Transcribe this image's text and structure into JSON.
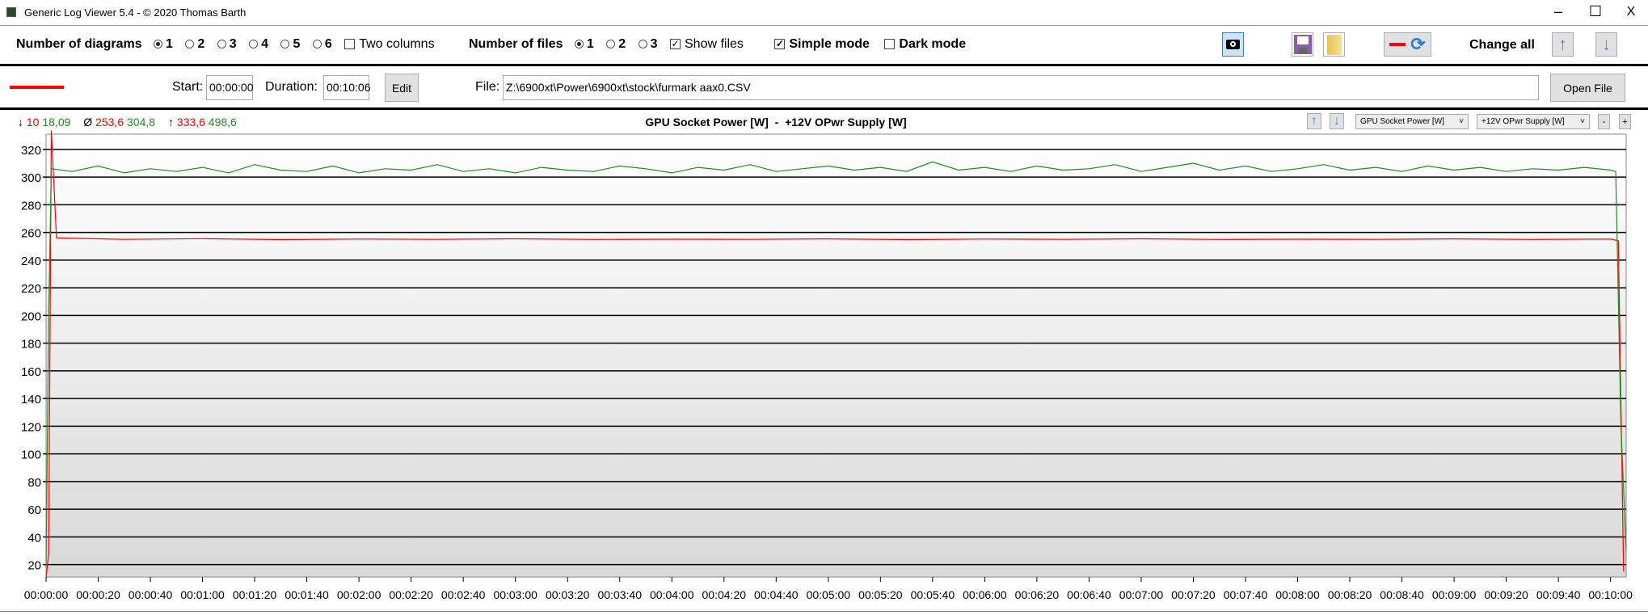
{
  "window": {
    "title": "Generic Log Viewer 5.4 - © 2020 Thomas Barth",
    "minimize": "–",
    "maximize": "☐",
    "close": "X"
  },
  "toolbar": {
    "diagrams_label": "Number of diagrams",
    "diagram_options": [
      "1",
      "2",
      "3",
      "4",
      "5",
      "6"
    ],
    "diagrams_selected": "1",
    "two_columns": "Two columns",
    "two_columns_checked": false,
    "files_label": "Number of files",
    "file_options": [
      "1",
      "2",
      "3"
    ],
    "files_selected": "1",
    "show_files": "Show files",
    "show_files_checked": true,
    "simple_mode": "Simple mode",
    "simple_mode_checked": true,
    "dark_mode": "Dark mode",
    "dark_mode_checked": false,
    "change_all": "Change all"
  },
  "file_row": {
    "line_color": "#ff0000",
    "start_label": "Start:",
    "start_value": "00:00:00",
    "duration_label": "Duration:",
    "duration_value": "00:10:06",
    "edit": "Edit",
    "file_label": "File:",
    "file_path": "Z:\\6900xt\\Power\\6900xt\\stock\\furmark aax0.CSV",
    "open_file": "Open File"
  },
  "stats": {
    "min_symbol": "↓",
    "min_a": "10",
    "min_b": "18,09",
    "avg_symbol": "Ø",
    "avg_a": "253,6",
    "avg_b": "304,8",
    "max_symbol": "↑",
    "max_a": "333,6",
    "max_b": "498,6"
  },
  "chart_header": {
    "title_a": "GPU Socket Power [W]",
    "sep": "-",
    "title_b": "+12V OPwr Supply [W]",
    "select_a": "GPU Socket Power [W]",
    "select_b": "+12V OPwr Supply [W]",
    "minus": "-",
    "plus": "+"
  },
  "chart_data": {
    "type": "line",
    "ylim": [
      11,
      331
    ],
    "yticks": [
      20,
      40,
      60,
      80,
      100,
      120,
      140,
      160,
      180,
      200,
      220,
      240,
      260,
      280,
      300,
      320
    ],
    "xticks": [
      "00:00:00",
      "00:00:20",
      "00:00:40",
      "00:01:00",
      "00:01:20",
      "00:01:40",
      "00:02:00",
      "00:02:20",
      "00:02:40",
      "00:03:00",
      "00:03:20",
      "00:03:40",
      "00:04:00",
      "00:04:20",
      "00:04:40",
      "00:05:00",
      "00:05:20",
      "00:05:40",
      "00:06:00",
      "00:06:20",
      "00:06:40",
      "00:07:00",
      "00:07:20",
      "00:07:40",
      "00:08:00",
      "00:08:20",
      "00:08:40",
      "00:09:00",
      "00:09:20",
      "00:09:40",
      "00:10:00"
    ],
    "xlim": [
      "00:00:00",
      "00:10:06"
    ],
    "grid": true,
    "series": [
      {
        "color": "#ff0000",
        "points": [
          [
            "00:00:00",
            10
          ],
          [
            "00:00:01",
            28
          ],
          [
            "00:00:02",
            333.6
          ],
          [
            "00:00:04",
            256
          ],
          [
            "00:00:30",
            255
          ],
          [
            "00:01:00",
            255.5
          ],
          [
            "00:01:30",
            254.8
          ],
          [
            "00:02:00",
            255.2
          ],
          [
            "00:02:30",
            255
          ],
          [
            "00:03:00",
            255.4
          ],
          [
            "00:03:30",
            254.9
          ],
          [
            "00:04:00",
            255.1
          ],
          [
            "00:04:30",
            255
          ],
          [
            "00:05:00",
            255.3
          ],
          [
            "00:05:30",
            254.8
          ],
          [
            "00:06:00",
            255.2
          ],
          [
            "00:06:30",
            255
          ],
          [
            "00:07:00",
            255.4
          ],
          [
            "00:07:30",
            254.9
          ],
          [
            "00:08:00",
            255.1
          ],
          [
            "00:08:30",
            255
          ],
          [
            "00:09:00",
            255.3
          ],
          [
            "00:09:30",
            254.9
          ],
          [
            "00:10:00",
            255.2
          ],
          [
            "00:10:03",
            254
          ],
          [
            "00:10:05",
            15
          ]
        ]
      },
      {
        "color": "#228b22",
        "points": [
          [
            "00:00:00",
            18
          ],
          [
            "00:00:01",
            200
          ],
          [
            "00:00:02",
            306
          ],
          [
            "00:00:10",
            304
          ],
          [
            "00:00:20",
            308
          ],
          [
            "00:00:30",
            303
          ],
          [
            "00:00:40",
            306
          ],
          [
            "00:00:50",
            304
          ],
          [
            "00:01:00",
            307
          ],
          [
            "00:01:10",
            303
          ],
          [
            "00:01:20",
            309
          ],
          [
            "00:01:30",
            305
          ],
          [
            "00:01:40",
            304
          ],
          [
            "00:01:50",
            308
          ],
          [
            "00:02:00",
            303
          ],
          [
            "00:02:10",
            306
          ],
          [
            "00:02:20",
            305
          ],
          [
            "00:02:30",
            309
          ],
          [
            "00:02:40",
            304
          ],
          [
            "00:02:50",
            306
          ],
          [
            "00:03:00",
            303
          ],
          [
            "00:03:10",
            307
          ],
          [
            "00:03:20",
            305
          ],
          [
            "00:03:30",
            304
          ],
          [
            "00:03:40",
            308
          ],
          [
            "00:03:50",
            306
          ],
          [
            "00:04:00",
            303
          ],
          [
            "00:04:10",
            307
          ],
          [
            "00:04:20",
            305
          ],
          [
            "00:04:30",
            309
          ],
          [
            "00:04:40",
            304
          ],
          [
            "00:04:50",
            306
          ],
          [
            "00:05:00",
            308
          ],
          [
            "00:05:10",
            305
          ],
          [
            "00:05:20",
            307
          ],
          [
            "00:05:30",
            304
          ],
          [
            "00:05:40",
            311
          ],
          [
            "00:05:50",
            305
          ],
          [
            "00:06:00",
            307
          ],
          [
            "00:06:10",
            304
          ],
          [
            "00:06:20",
            308
          ],
          [
            "00:06:30",
            305
          ],
          [
            "00:06:40",
            306
          ],
          [
            "00:06:50",
            309
          ],
          [
            "00:07:00",
            304
          ],
          [
            "00:07:10",
            307
          ],
          [
            "00:07:20",
            310
          ],
          [
            "00:07:30",
            305
          ],
          [
            "00:07:40",
            308
          ],
          [
            "00:07:50",
            304
          ],
          [
            "00:08:00",
            306
          ],
          [
            "00:08:10",
            309
          ],
          [
            "00:08:20",
            305
          ],
          [
            "00:08:30",
            307
          ],
          [
            "00:08:40",
            304
          ],
          [
            "00:08:50",
            308
          ],
          [
            "00:09:00",
            305
          ],
          [
            "00:09:10",
            307
          ],
          [
            "00:09:20",
            304
          ],
          [
            "00:09:30",
            306
          ],
          [
            "00:09:40",
            305
          ],
          [
            "00:09:50",
            307
          ],
          [
            "00:10:00",
            305
          ],
          [
            "00:10:02",
            304
          ],
          [
            "00:10:04",
            120
          ],
          [
            "00:10:06",
            30
          ]
        ]
      }
    ]
  }
}
